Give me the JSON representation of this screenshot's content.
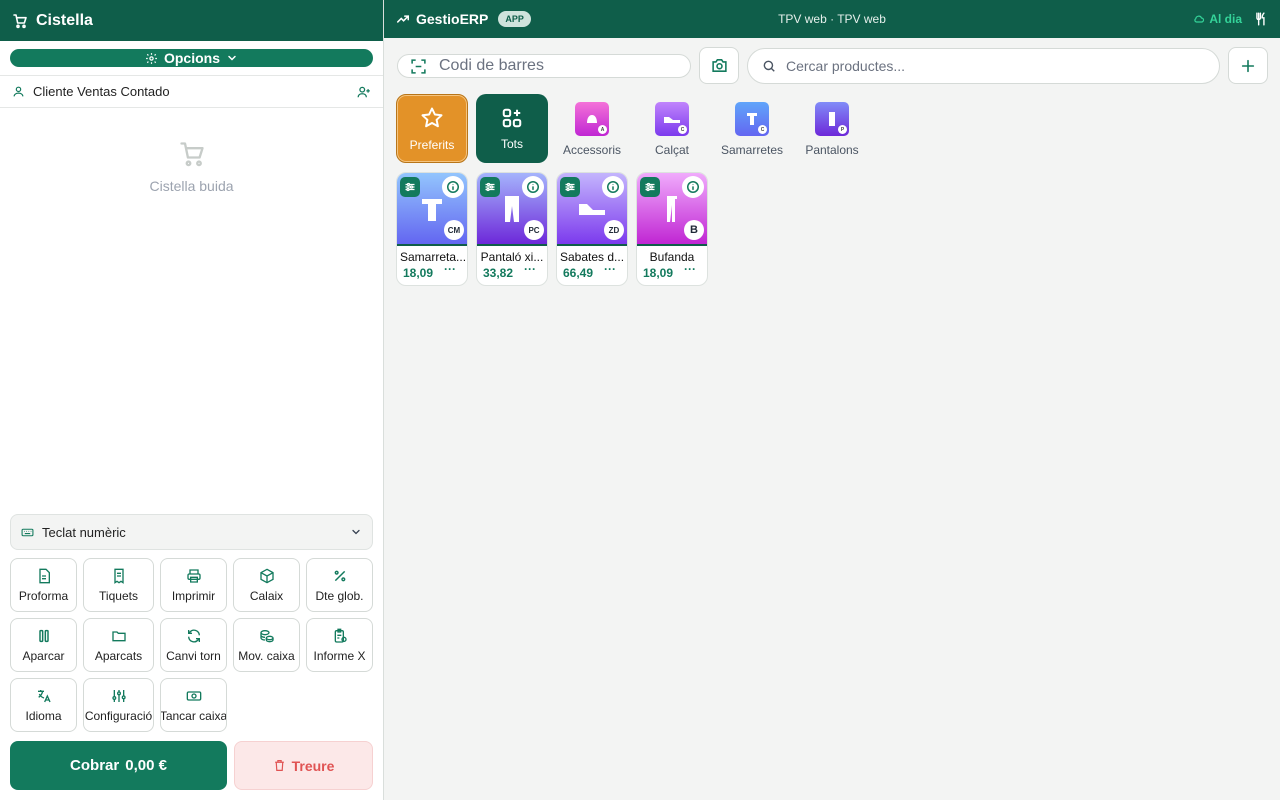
{
  "cart": {
    "title": "Cistella",
    "options_label": "Opcions",
    "client_name": "Cliente Ventas Contado",
    "empty_text": "Cistella buida",
    "keypad_label": "Teclat numèric",
    "actions": [
      {
        "label": "Proforma",
        "icon": "document-icon"
      },
      {
        "label": "Tiquets",
        "icon": "receipt-icon"
      },
      {
        "label": "Imprimir",
        "icon": "printer-icon"
      },
      {
        "label": "Calaix",
        "icon": "box-icon"
      },
      {
        "label": "Dte glob.",
        "icon": "percent-icon"
      },
      {
        "label": "Aparcar",
        "icon": "pause-icon"
      },
      {
        "label": "Aparcats",
        "icon": "folder-icon"
      },
      {
        "label": "Canvi torn",
        "icon": "refresh-icon"
      },
      {
        "label": "Mov. caixa",
        "icon": "coins-icon"
      },
      {
        "label": "Informe X",
        "icon": "clipboard-icon"
      },
      {
        "label": "Idioma",
        "icon": "translate-icon"
      },
      {
        "label": "Configuració",
        "icon": "sliders-icon"
      },
      {
        "label": "Tancar caixa",
        "icon": "cash-icon"
      }
    ],
    "pay_label": "Cobrar",
    "pay_amount": "0,00 €",
    "remove_label": "Treure"
  },
  "header": {
    "brand": "GestioERP",
    "badge": "APP",
    "center_title": "TPV web · TPV web",
    "status": "Al dia"
  },
  "toolbar": {
    "barcode_placeholder": "Codi de barres",
    "search_placeholder": "Cercar productes..."
  },
  "categories": {
    "favorites": "Preferits",
    "all": "Tots",
    "items": [
      {
        "label": "Accessoris",
        "mini": "A"
      },
      {
        "label": "Calçat",
        "mini": "C"
      },
      {
        "label": "Samarretes",
        "mini": "C"
      },
      {
        "label": "Pantalons",
        "mini": "P"
      }
    ]
  },
  "products": [
    {
      "name": "Samarreta...",
      "price": "18,09",
      "code": "CM"
    },
    {
      "name": "Pantaló xi...",
      "price": "33,82",
      "code": "PC"
    },
    {
      "name": "Sabates d...",
      "price": "66,49",
      "code": "ZD"
    },
    {
      "name": "Bufanda",
      "price": "18,09",
      "code": "B"
    }
  ],
  "colors": {
    "primary": "#0f5e4a",
    "accent": "#137a5d",
    "favorite": "#e39228",
    "danger": "#e05353",
    "status_ok": "#34d399"
  }
}
